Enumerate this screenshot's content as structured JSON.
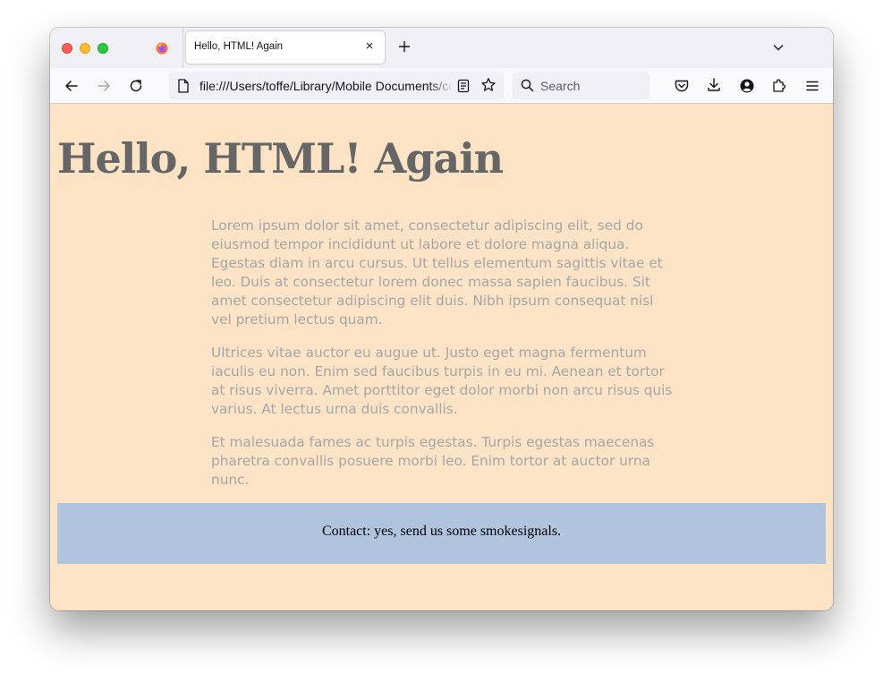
{
  "browser": {
    "tab": {
      "title": "Hello, HTML! Again",
      "close_glyph": "×"
    },
    "url": "file:///Users/toffe/Library/Mobile Documents/com~apple~CloudDocs/",
    "search_placeholder": "Search"
  },
  "page": {
    "heading": "Hello, HTML! Again",
    "paragraphs": [
      "Lorem ipsum dolor sit amet, consectetur adipiscing elit, sed do eiusmod tempor incididunt ut labore et dolore magna aliqua. Egestas diam in arcu cursus. Ut tellus elementum sagittis vitae et leo. Duis at consectetur lorem donec massa sapien faucibus. Sit amet consectetur adipiscing elit duis. Nibh ipsum consequat nisl vel pretium lectus quam.",
      "Ultrices vitae auctor eu augue ut. Justo eget magna fermentum iaculis eu non. Enim sed faucibus turpis in eu mi. Aenean et tortor at risus viverra. Amet porttitor eget dolor morbi non arcu risus quis varius. At lectus urna duis convallis.",
      "Et malesuada fames ac turpis egestas. Turpis egestas maecenas pharetra convallis posuere morbi leo. Enim tortor at auctor urna nunc."
    ],
    "footer": "Contact: yes, send us some smokesignals."
  },
  "colors": {
    "page_background": "#fce3c6",
    "heading": "#666666",
    "paragraph": "#a6a6a6",
    "footer_background": "#b0c4de"
  }
}
